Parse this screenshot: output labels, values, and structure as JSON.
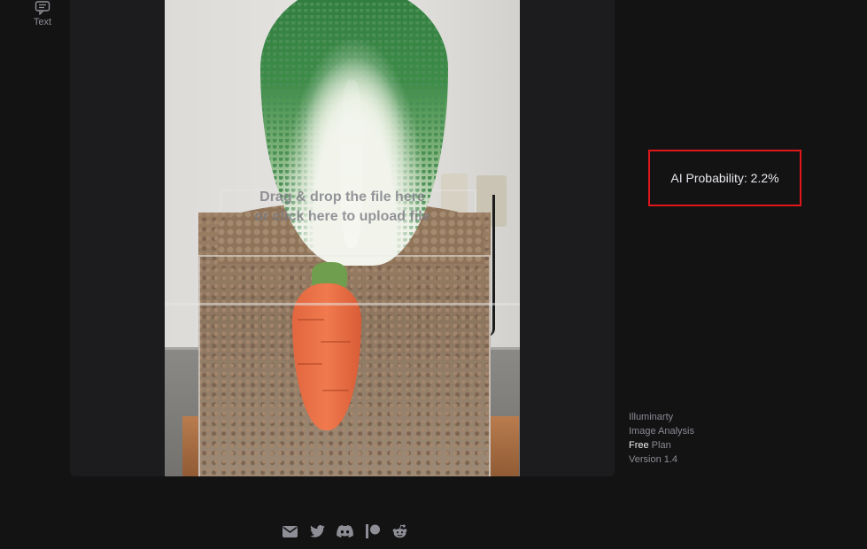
{
  "sidebar": {
    "items": [
      {
        "label": "Text",
        "icon": "message-square-text-icon"
      }
    ]
  },
  "upload": {
    "hint_line1": "Drag & drop the file here",
    "hint_line2": "or click here to upload file"
  },
  "result": {
    "label": "AI Probability: 2.2%",
    "border_color": "#e0161a"
  },
  "info": {
    "app_name": "Illuminarty",
    "product": "Image Analysis",
    "plan_name": "Free",
    "plan_suffix": " Plan",
    "version": "Version 1.4"
  },
  "footer": {
    "icons": [
      "email-icon",
      "twitter-icon",
      "discord-icon",
      "patreon-icon",
      "reddit-icon"
    ]
  }
}
